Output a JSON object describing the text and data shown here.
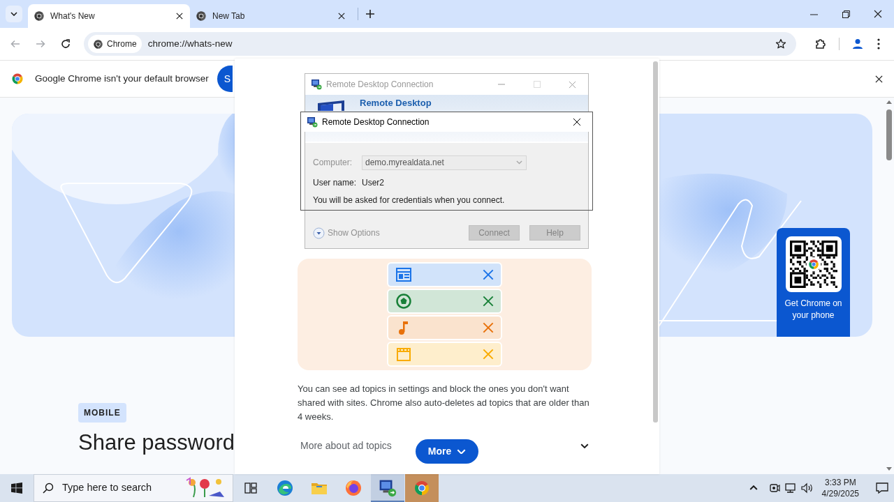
{
  "browser": {
    "tabs": [
      {
        "title": "What's New",
        "selected": true
      },
      {
        "title": "New Tab",
        "selected": false
      }
    ],
    "nav": [
      {
        "kind": "back",
        "disabled": true
      },
      {
        "kind": "forward",
        "disabled": true
      },
      {
        "kind": "reload",
        "disabled": false
      }
    ],
    "omnibox": {
      "chip": "Chrome",
      "url": "chrome://whats-new",
      "bookmarked": false
    }
  },
  "infobar": {
    "message": "Google Chrome isn't your default browser",
    "button": "S"
  },
  "page": {
    "qr_caption": "Get Chrome on your phone",
    "badge": "MOBILE",
    "heading": "Share password"
  },
  "whats_new_panel": {
    "topics": [
      {
        "kind": "news",
        "color": "#1a73e8"
      },
      {
        "kind": "sports",
        "color": "#188038"
      },
      {
        "kind": "music",
        "color": "#e8710a"
      },
      {
        "kind": "movies",
        "color": "#f9ab00"
      }
    ],
    "paragraph": "You can see ad topics in settings and block the ones you don't want shared with sites. Chrome also auto-deletes ad topics that are older than 4 weeks.",
    "expander": {
      "label": "More about ad topics",
      "expanded": false
    },
    "more_button": "More"
  },
  "rdp_window": {
    "title": "Remote Desktop Connection",
    "active": false,
    "banner": "Remote Desktop",
    "computer_label": "Computer:",
    "computer": "demo.myrealdata.net",
    "fields_disabled": true,
    "username_label": "User name:",
    "username": "User2",
    "note": "You will be asked for credentials when you connect.",
    "show_options": "Show Options",
    "buttons": [
      {
        "label": "Connect",
        "disabled": true
      },
      {
        "label": "Help",
        "disabled": true
      }
    ]
  },
  "rdp_dialog": {
    "title": "Remote Desktop Connection",
    "active": true
  },
  "taskbar": {
    "search_placeholder": "Type here to search",
    "apps": [
      {
        "kind": "task_view",
        "focused": false,
        "flashing": false
      },
      {
        "kind": "edge",
        "focused": false,
        "flashing": false
      },
      {
        "kind": "explorer",
        "focused": false,
        "flashing": false
      },
      {
        "kind": "firefox",
        "focused": false,
        "flashing": false
      },
      {
        "kind": "rdp",
        "focused": true,
        "flashing": false
      },
      {
        "kind": "chrome",
        "focused": false,
        "flashing": true
      }
    ],
    "time": "3:33 PM",
    "date": "4/29/2025"
  }
}
